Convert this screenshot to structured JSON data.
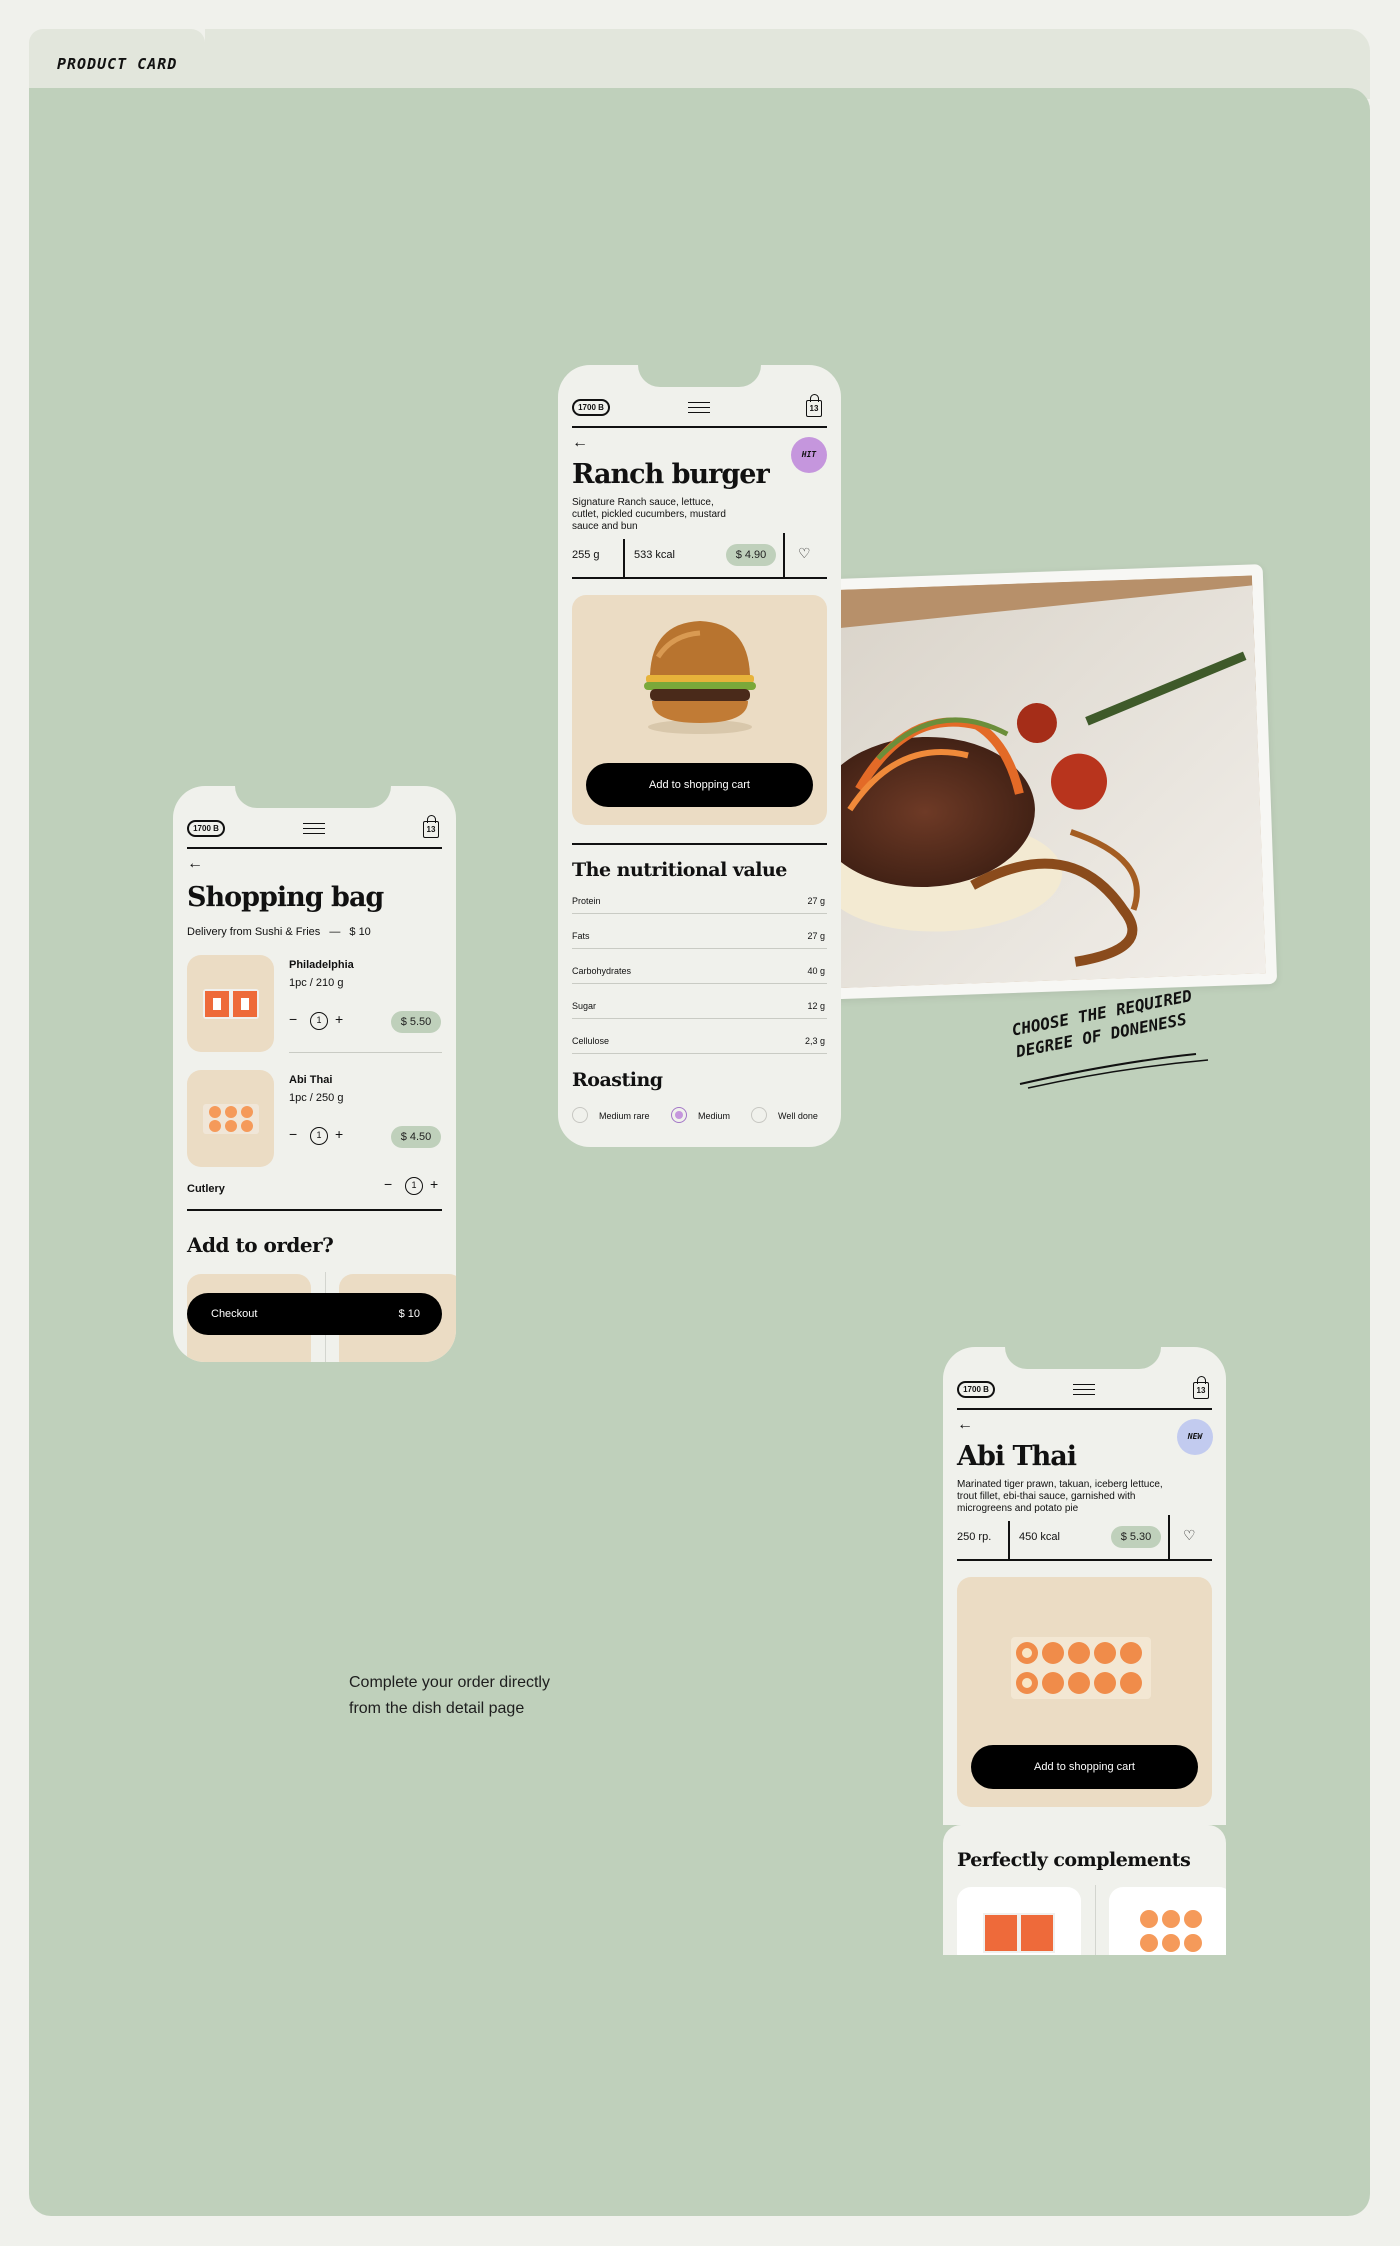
{
  "page": {
    "tab_label": "PRODUCT CARD",
    "caption_line1": "Complete your order directly",
    "caption_line2": "from the dish detail page",
    "note_line1": "CHOOSE THE REQUIRED",
    "note_line2": "DEGREE OF DONENESS"
  },
  "ranch": {
    "balance": "1700 B",
    "cart_count": "13",
    "badge": "HIT",
    "title": "Ranch burger",
    "desc_line1": "Signature Ranch sauce, lettuce,",
    "desc_line2": "cutlet, pickled cucumbers, mustard",
    "desc_line3": "sauce and bun",
    "weight": "255 g",
    "kcal": "533 kcal",
    "price": "$ 4.90",
    "cart_button": "Add to shopping cart",
    "nutrition_title": "The nutritional value",
    "nutrition": [
      {
        "name": "Protein",
        "value": "27 g"
      },
      {
        "name": "Fats",
        "value": "27 g"
      },
      {
        "name": "Carbohydrates",
        "value": "40 g"
      },
      {
        "name": "Sugar",
        "value": "12 g"
      },
      {
        "name": "Cellulose",
        "value": "2,3 g"
      }
    ],
    "roasting_title": "Roasting",
    "roasting_options": [
      "Medium rare",
      "Medium",
      "Well done"
    ],
    "roasting_selected": "Medium"
  },
  "bag": {
    "balance": "1700 B",
    "cart_count": "13",
    "title": "Shopping bag",
    "delivery": "Delivery from Sushi & Fries",
    "delivery_sep": "—",
    "delivery_total": "$ 10",
    "items": [
      {
        "name": "Philadelphia",
        "portion": "1pc / 210 g",
        "qty": "1",
        "price": "$ 5.50"
      },
      {
        "name": "Abi Thai",
        "portion": "1pc / 250 g",
        "qty": "1",
        "price": "$ 4.50"
      }
    ],
    "cutlery_label": "Cutlery",
    "cutlery_qty": "1",
    "add_title": "Add to order?",
    "checkout_label": "Checkout",
    "checkout_total": "$ 10"
  },
  "abi": {
    "balance": "1700 B",
    "cart_count": "13",
    "badge": "NEW",
    "title": "Abi Thai",
    "desc_line1": "Marinated tiger prawn, takuan, iceberg lettuce,",
    "desc_line2": "trout fillet, ebi-thai sauce, garnished with",
    "desc_line3": "microgreens and potato pie",
    "weight": "250 rp.",
    "kcal": "450 kcal",
    "price": "$ 5.30",
    "cart_button": "Add to shopping cart",
    "complements_title": "Perfectly complements"
  },
  "colors": {
    "board": "#bfd0bb",
    "food_bg": "#ebdcc4",
    "hit_badge": "#c596dd",
    "new_badge": "#c2cbef",
    "price_pill": "#bfd0bb"
  }
}
